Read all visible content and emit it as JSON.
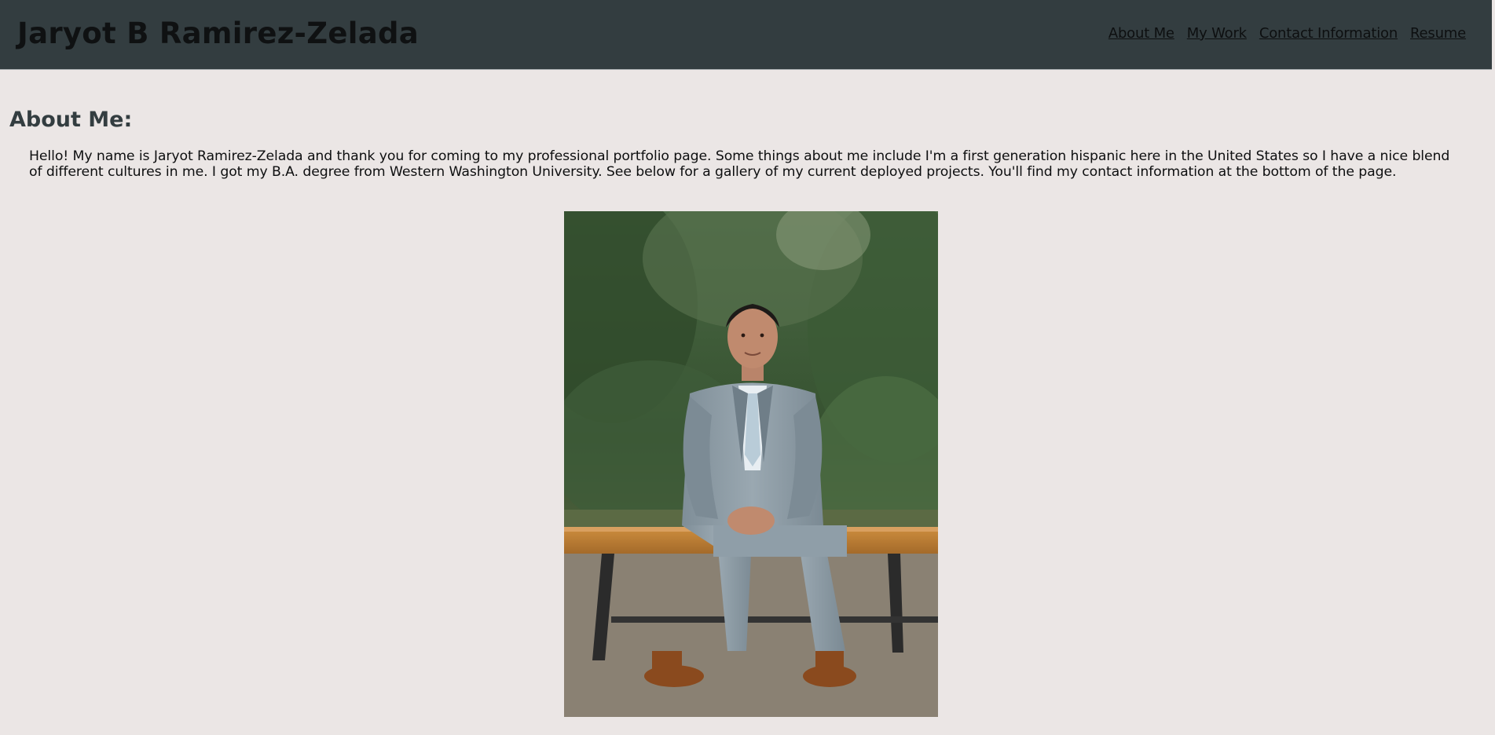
{
  "header": {
    "title": "Jaryot B Ramirez-Zelada",
    "nav": [
      {
        "label": "About Me"
      },
      {
        "label": "My Work"
      },
      {
        "label": "Contact Information"
      },
      {
        "label": "Resume"
      }
    ]
  },
  "about": {
    "heading": "About Me:",
    "text": "Hello! My name is Jaryot Ramirez-Zelada and thank you for coming to my professional portfolio page. Some things about me include I'm a first generation hispanic here in the United States so I have a nice blend of different cultures in me. I got my B.A. degree from Western Washington University. See below for a gallery of my current deployed projects. You'll find my contact information at the bottom of the page."
  },
  "colors": {
    "header_bg": "#333d40",
    "page_bg": "#ebe6e5",
    "heading_color": "#333d40",
    "text_color": "#0e0f10"
  }
}
